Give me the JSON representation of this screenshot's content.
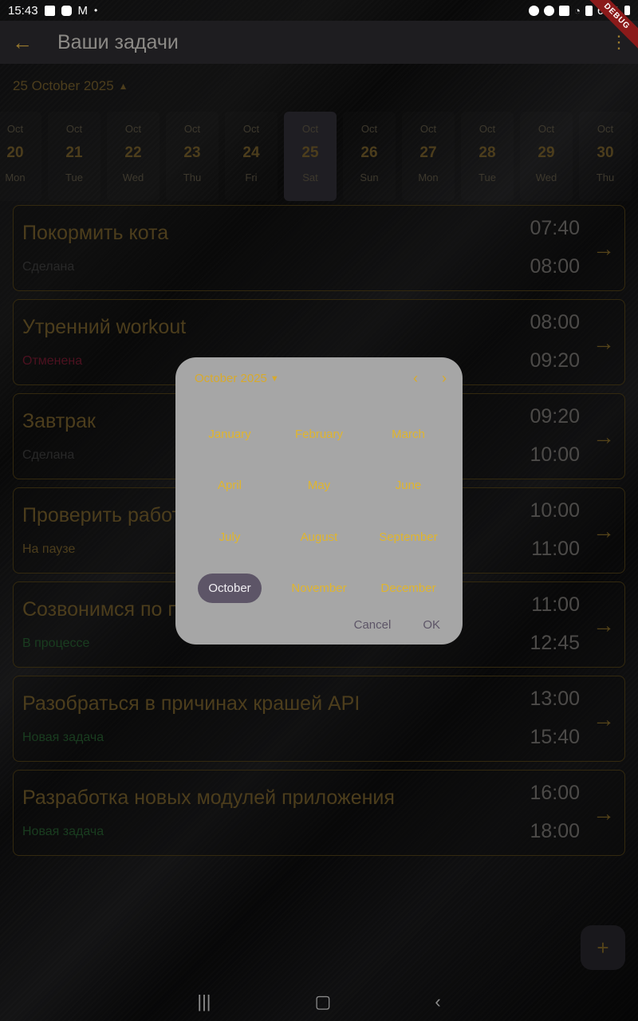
{
  "statusbar": {
    "time": "15:43",
    "battery": "62%"
  },
  "debug_label": "DEBUG",
  "appbar": {
    "title": "Ваши задачи"
  },
  "selected_date": "25 October 2025",
  "days": [
    {
      "month": "Oct",
      "day": "20",
      "weekday": "Mon"
    },
    {
      "month": "Oct",
      "day": "21",
      "weekday": "Tue"
    },
    {
      "month": "Oct",
      "day": "22",
      "weekday": "Wed"
    },
    {
      "month": "Oct",
      "day": "23",
      "weekday": "Thu"
    },
    {
      "month": "Oct",
      "day": "24",
      "weekday": "Fri"
    },
    {
      "month": "Oct",
      "day": "25",
      "weekday": "Sat"
    },
    {
      "month": "Oct",
      "day": "26",
      "weekday": "Sun"
    },
    {
      "month": "Oct",
      "day": "27",
      "weekday": "Mon"
    },
    {
      "month": "Oct",
      "day": "28",
      "weekday": "Tue"
    },
    {
      "month": "Oct",
      "day": "29",
      "weekday": "Wed"
    },
    {
      "month": "Oct",
      "day": "30",
      "weekday": "Thu"
    }
  ],
  "tasks": [
    {
      "name": "Покормить кота",
      "status": "Сделана",
      "status_color": "#4a4a4a",
      "start": "07:40",
      "end": "08:00"
    },
    {
      "name": "Утренний workout",
      "status": "Отменена",
      "status_color": "#8a1f3a",
      "start": "08:00",
      "end": "09:20"
    },
    {
      "name": "Завтрак",
      "status": "Сделана",
      "status_color": "#4a4a4a",
      "start": "09:20",
      "end": "10:00"
    },
    {
      "name": "Проверить работу",
      "status": "На паузе",
      "status_color": "#8a7034",
      "start": "10:00",
      "end": "11:00"
    },
    {
      "name": "Созвонимся по проекту",
      "status": "В процессе",
      "status_color": "#2e6e3a",
      "start": "11:00",
      "end": "12:45"
    },
    {
      "name": "Разобраться в причинах крашей API",
      "status": "Новая задача",
      "status_color": "#2e6e3a",
      "start": "13:00",
      "end": "15:40"
    },
    {
      "name": "Разработка новых модулей приложения",
      "status": "Новая задача",
      "status_color": "#2e6e3a",
      "start": "16:00",
      "end": "18:00"
    }
  ],
  "dialog": {
    "header": "October 2025",
    "months": [
      "January",
      "February",
      "March",
      "April",
      "May",
      "June",
      "July",
      "August",
      "September",
      "October",
      "November",
      "December"
    ],
    "selected_month": "October",
    "cancel_label": "Cancel",
    "ok_label": "OK"
  },
  "fab_icon": "plus-icon"
}
